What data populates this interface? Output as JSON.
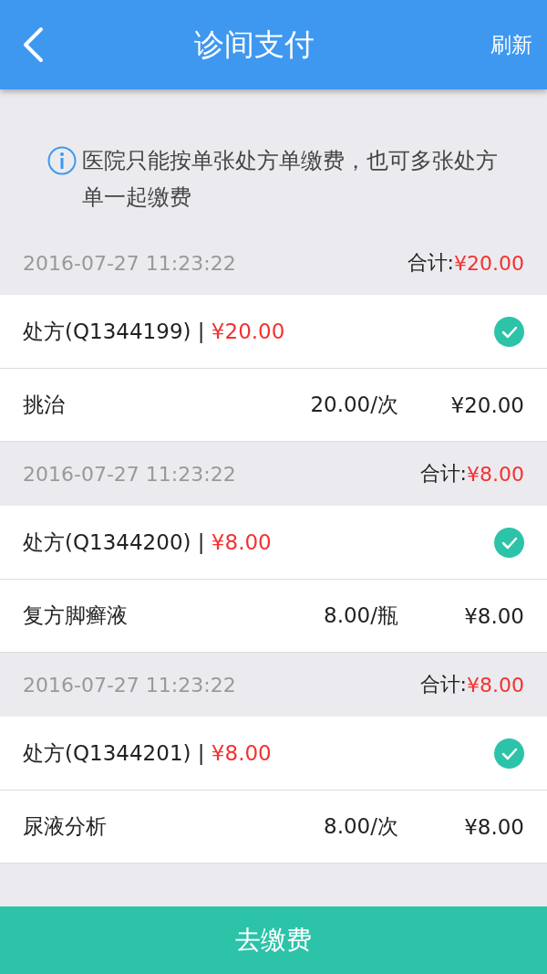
{
  "header": {
    "title": "诊间支付",
    "action": "刷新"
  },
  "notice": "医院只能按单张处方单缴费，也可多张处方单一起缴费",
  "groups": [
    {
      "date": "2016-07-27 11:23:22",
      "total_label": "合计:",
      "total_amount": "¥20.00",
      "prescription": {
        "title": "处方(Q1344199) |",
        "amount": "¥20.00",
        "checked": true
      },
      "items": [
        {
          "name": "挑治",
          "unit_price": "20.00/次",
          "amount": "¥20.00"
        }
      ]
    },
    {
      "date": "2016-07-27 11:23:22",
      "total_label": "合计:",
      "total_amount": "¥8.00",
      "prescription": {
        "title": "处方(Q1344200) |",
        "amount": "¥8.00",
        "checked": true
      },
      "items": [
        {
          "name": "复方脚癣液",
          "unit_price": "8.00/瓶",
          "amount": "¥8.00"
        }
      ]
    },
    {
      "date": "2016-07-27 11:23:22",
      "total_label": "合计:",
      "total_amount": "¥8.00",
      "prescription": {
        "title": "处方(Q1344201) |",
        "amount": "¥8.00",
        "checked": true
      },
      "items": [
        {
          "name": "尿液分析",
          "unit_price": "8.00/次",
          "amount": "¥8.00"
        }
      ]
    }
  ],
  "pay_button": "去缴费"
}
